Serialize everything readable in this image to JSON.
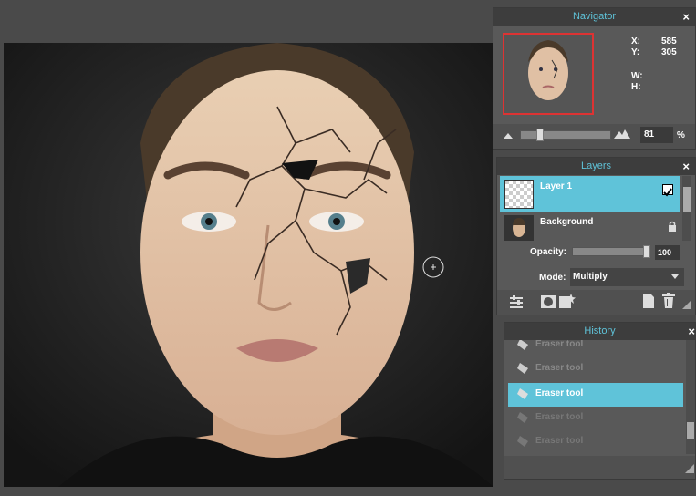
{
  "canvas": {
    "cursor": "brush-circle-cursor"
  },
  "navigator": {
    "title": "Navigator",
    "close": "×",
    "x_label": "X:",
    "x_value": "585",
    "y_label": "Y:",
    "y_value": "305",
    "w_label": "W:",
    "h_label": "H:",
    "zoom_value": "81",
    "zoom_unit": "%"
  },
  "layers": {
    "title": "Layers",
    "close": "×",
    "items": [
      {
        "name": "Layer 1",
        "selected": true,
        "visible_checkbox": true
      },
      {
        "name": "Background",
        "locked": true
      }
    ],
    "opacity_label": "Opacity:",
    "opacity_value": "100",
    "mode_label": "Mode:",
    "mode_value": "Multiply"
  },
  "history": {
    "title": "History",
    "close": "×",
    "items": [
      {
        "label": "Eraser tool",
        "state": "past"
      },
      {
        "label": "Eraser tool",
        "state": "past"
      },
      {
        "label": "Eraser tool",
        "state": "current"
      },
      {
        "label": "Eraser tool",
        "state": "undone"
      },
      {
        "label": "Eraser tool",
        "state": "undone"
      }
    ]
  },
  "colors": {
    "accent": "#5fc3d9",
    "panel_bg": "#595959",
    "header_bg": "#3d3d3d",
    "workspace_bg": "#4a4a4a"
  }
}
